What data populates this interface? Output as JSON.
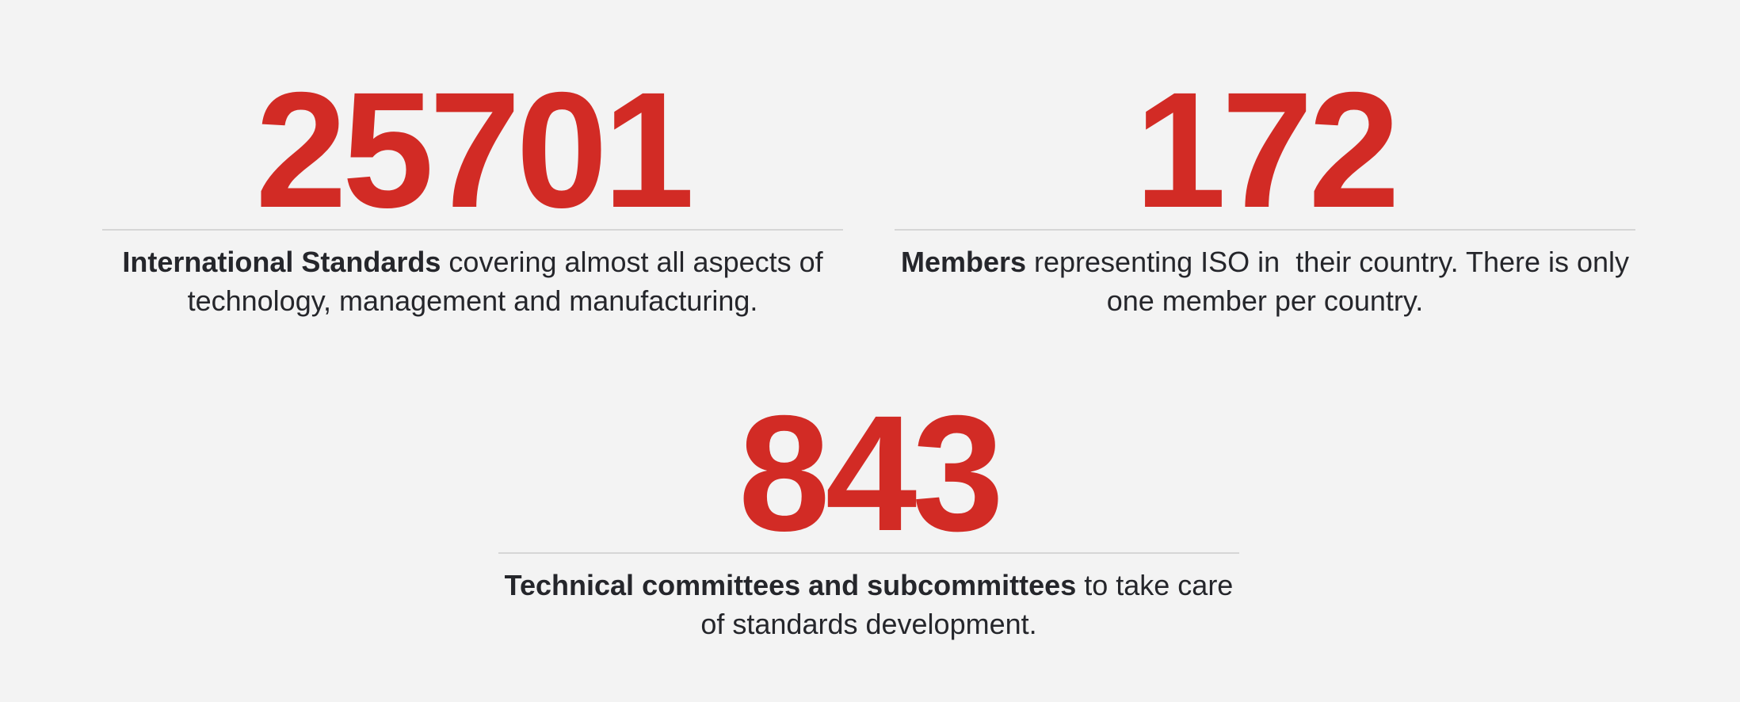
{
  "accent_color": "#d22b25",
  "stats": [
    {
      "value": "25701",
      "caption_bold": "International Standards",
      "caption_rest": " covering almost all aspects of technology, management and manufacturing."
    },
    {
      "value": "172",
      "caption_bold": "Members",
      "caption_rest": " representing ISO in  their country. There is only one member per country."
    },
    {
      "value": "843",
      "caption_bold": "Technical committees and subcommittees",
      "caption_rest": " to take care of standards development."
    }
  ]
}
